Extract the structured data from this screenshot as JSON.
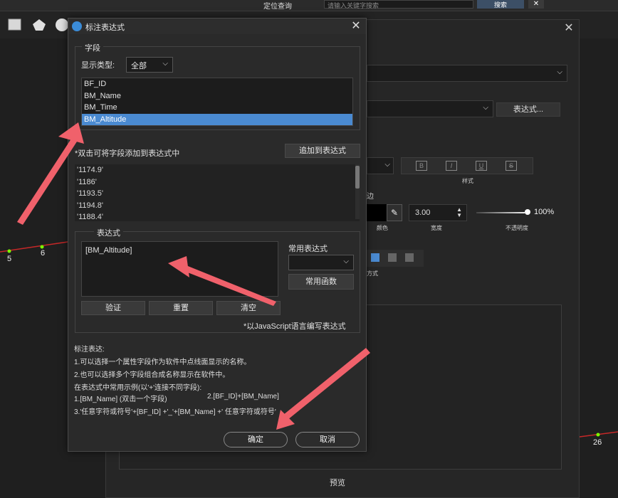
{
  "background": {
    "top_bar": {
      "search_label": "定位查询",
      "search_placeholder": "请输入关键字搜索",
      "search_button": "搜索"
    },
    "map_points": [
      {
        "label": "5"
      },
      {
        "label": "6"
      },
      {
        "label": "26"
      }
    ],
    "style_panel": {
      "expression_button": "表达式...",
      "bold": "B",
      "italic": "I",
      "underline": "U",
      "strike": "S",
      "style_caption": "样式",
      "edge_caption": "边",
      "color_caption": "颜色",
      "width_value": "3.00",
      "width_caption": "宽度",
      "opacity_value": "100%",
      "opacity_caption": "不透明度",
      "align_caption": "方式",
      "preview_label": "预览"
    }
  },
  "dialog": {
    "title": "标注表达式",
    "field_group": {
      "label": "字段",
      "display_type_label": "显示类型:",
      "display_type_value": "全部",
      "fields": [
        {
          "name": "BF_ID",
          "selected": false
        },
        {
          "name": "BM_Name",
          "selected": false
        },
        {
          "name": "BM_Time",
          "selected": false
        },
        {
          "name": "BM_Altitude",
          "selected": true
        }
      ]
    },
    "hint_double_click": "*双击可将字段添加到表达式中",
    "add_to_expression": "追加到表达式",
    "values": [
      "'1174.9'",
      "'1186'",
      "'1193.5'",
      "'1194.8'",
      "'1188.4'"
    ],
    "expression_group": {
      "label": "表达式",
      "expression": "[BM_Altitude]",
      "common_label": "常用表达式",
      "common_select_value": "",
      "common_functions": "常用函数",
      "verify": "验证",
      "reset": "重置",
      "clear": "清空",
      "js_hint": "*以JavaScript语言编写表达式"
    },
    "help": {
      "title": "标注表达:",
      "line1": "1.可以选择一个属性字段作为软件中点线面显示的名称。",
      "line2": "2.也可以选择多个字段组合成名称显示在软件中。",
      "line3": "在表达式中常用示例(以'+'连接不同字段):",
      "line4a": "1.[BM_Name]   (双击一个字段)",
      "line4b": "2.[BF_ID]+[BM_Name]",
      "line5": "3.'任意字符或符号'+[BF_ID] +'_'+[BM_Name] +' 任意字符或符号'"
    },
    "ok": "确定",
    "cancel": "取消"
  },
  "colors": {
    "accent": "#4a8ad1",
    "arrow": "#f0616b",
    "map_line": "#c62828",
    "map_point": "#7cfc00"
  }
}
